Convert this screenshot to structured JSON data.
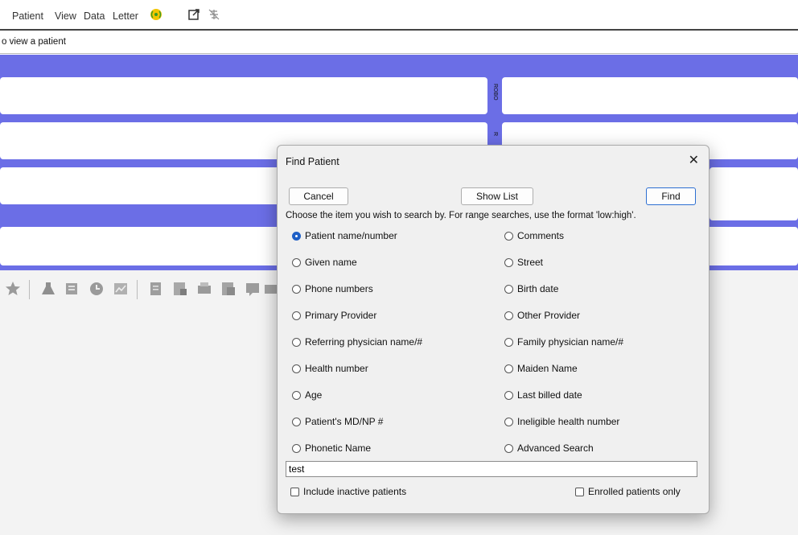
{
  "menubar": {
    "items": [
      "Patient",
      "View",
      "Data",
      "Letter"
    ],
    "icons": [
      "radio-wave-icon",
      "external-link-icon",
      "network-off-icon"
    ]
  },
  "status": {
    "text": "o view a patient"
  },
  "side_labels": {
    "upper": "ROBO",
    "lower": "R"
  },
  "dialog": {
    "title": "Find Patient",
    "close_glyph": "✕",
    "buttons": {
      "cancel": "Cancel",
      "show_list": "Show List",
      "find": "Find"
    },
    "hint": "Choose the item you wish to search by.  For range searches, use the format 'low:high'.",
    "options_left": [
      "Patient name/number",
      "Given name",
      "Phone numbers",
      "Primary Provider",
      "Referring physician name/#",
      "Health number",
      "Age",
      "Patient's MD/NP #",
      "Phonetic Name"
    ],
    "options_right": [
      "Comments",
      "Street",
      "Birth date",
      "Other Provider",
      "Family physician name/#",
      "Maiden Name",
      "Last billed date",
      "Ineligible health number",
      "Advanced Search"
    ],
    "selected": "Patient name/number",
    "search_value": "test",
    "include_inactive": "Include inactive patients",
    "enrolled_only": "Enrolled patients only"
  },
  "colors": {
    "band": "#6b6ee6",
    "accent": "#1e5fc6"
  }
}
